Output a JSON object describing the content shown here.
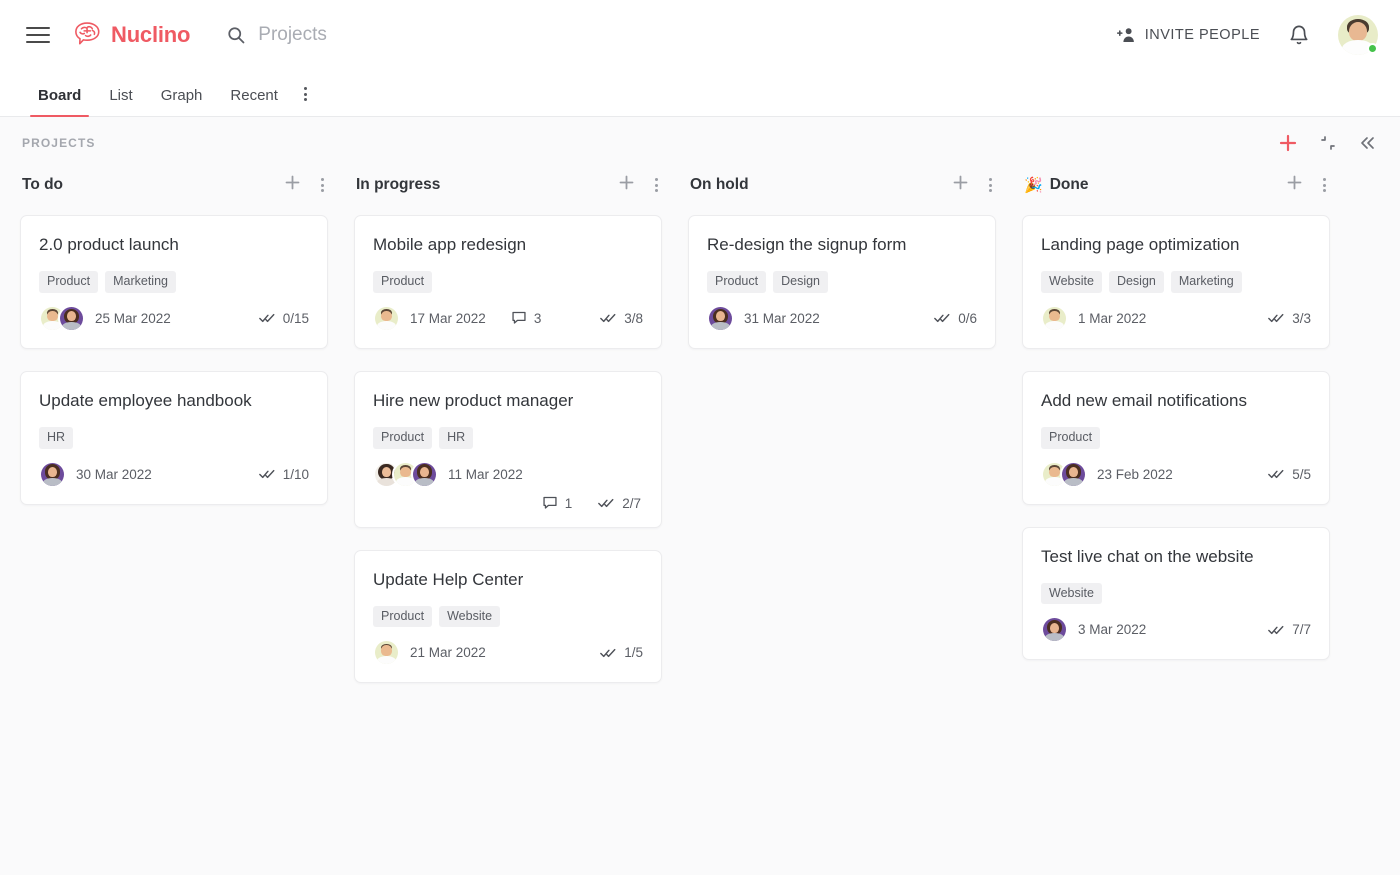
{
  "header": {
    "menu_icon": "hamburger-icon",
    "brand": "Nuclino",
    "brand_color": "#ef5a63",
    "search_icon": "search-icon",
    "search_value": "",
    "search_placeholder": "Projects",
    "invite_label": "INVITE PEOPLE",
    "invite_icon": "add-person-icon",
    "notifications_icon": "bell-icon",
    "avatar": "user-avatar",
    "status": "online"
  },
  "tabs": {
    "items": [
      {
        "label": "Board",
        "active": true
      },
      {
        "label": "List",
        "active": false
      },
      {
        "label": "Graph",
        "active": false
      },
      {
        "label": "Recent",
        "active": false
      }
    ],
    "more_icon": "more-vertical-icon"
  },
  "board": {
    "title": "PROJECTS",
    "actions": [
      {
        "name": "add-item-button",
        "icon": "plus-icon",
        "color": "#ef5a63"
      },
      {
        "name": "collapse-view-button",
        "icon": "collapse-icon",
        "color": "#6f7279"
      },
      {
        "name": "collapse-sidebar-button",
        "icon": "chevrons-left-icon",
        "color": "#6f7279"
      }
    ],
    "columns": [
      {
        "name": "To do",
        "emoji": "",
        "add_icon": "plus-icon",
        "menu_icon": "more-vertical-icon",
        "cards": [
          {
            "title": "2.0 product launch",
            "tags": [
              "Product",
              "Marketing"
            ],
            "avatars": [
              "man-yellow",
              "woman-purple"
            ],
            "date": "25 Mar 2022",
            "comments": null,
            "tasks": "0/15"
          },
          {
            "title": "Update employee handbook",
            "tags": [
              "HR"
            ],
            "avatars": [
              "woman-purple"
            ],
            "date": "30 Mar 2022",
            "comments": null,
            "tasks": "1/10"
          }
        ]
      },
      {
        "name": "In progress",
        "emoji": "",
        "add_icon": "plus-icon",
        "menu_icon": "more-vertical-icon",
        "cards": [
          {
            "title": "Mobile app redesign",
            "tags": [
              "Product"
            ],
            "avatars": [
              "man-yellow"
            ],
            "date": "17 Mar 2022",
            "comments": "3",
            "tasks": "3/8"
          },
          {
            "title": "Hire new product manager",
            "tags": [
              "Product",
              "HR"
            ],
            "avatars": [
              "woman-dark",
              "man-yellow",
              "woman-purple"
            ],
            "date": "11 Mar 2022",
            "comments": "1",
            "tasks": "2/7",
            "wrap_meta": true
          },
          {
            "title": "Update Help Center",
            "tags": [
              "Product",
              "Website"
            ],
            "avatars": [
              "man-yellow"
            ],
            "date": "21 Mar 2022",
            "comments": null,
            "tasks": "1/5"
          }
        ]
      },
      {
        "name": "On hold",
        "emoji": "",
        "add_icon": "plus-icon",
        "menu_icon": "more-vertical-icon",
        "cards": [
          {
            "title": "Re-design the signup form",
            "tags": [
              "Product",
              "Design"
            ],
            "avatars": [
              "woman-purple"
            ],
            "date": "31 Mar 2022",
            "comments": null,
            "tasks": "0/6"
          }
        ]
      },
      {
        "name": "Done",
        "emoji": "🎉",
        "add_icon": "plus-icon",
        "menu_icon": "more-vertical-icon",
        "cards": [
          {
            "title": "Landing page optimization",
            "tags": [
              "Website",
              "Design",
              "Marketing"
            ],
            "avatars": [
              "man-yellow"
            ],
            "date": "1 Mar 2022",
            "comments": null,
            "tasks": "3/3"
          },
          {
            "title": "Add new email notifications",
            "tags": [
              "Product"
            ],
            "avatars": [
              "man-yellow",
              "woman-purple"
            ],
            "date": "23 Feb 2022",
            "comments": null,
            "tasks": "5/5"
          },
          {
            "title": "Test live chat on the website",
            "tags": [
              "Website"
            ],
            "avatars": [
              "woman-purple"
            ],
            "date": "3 Mar 2022",
            "comments": null,
            "tasks": "7/7"
          }
        ]
      }
    ]
  },
  "icons": {
    "tasks": "double-check-icon",
    "comments": "comment-icon"
  }
}
